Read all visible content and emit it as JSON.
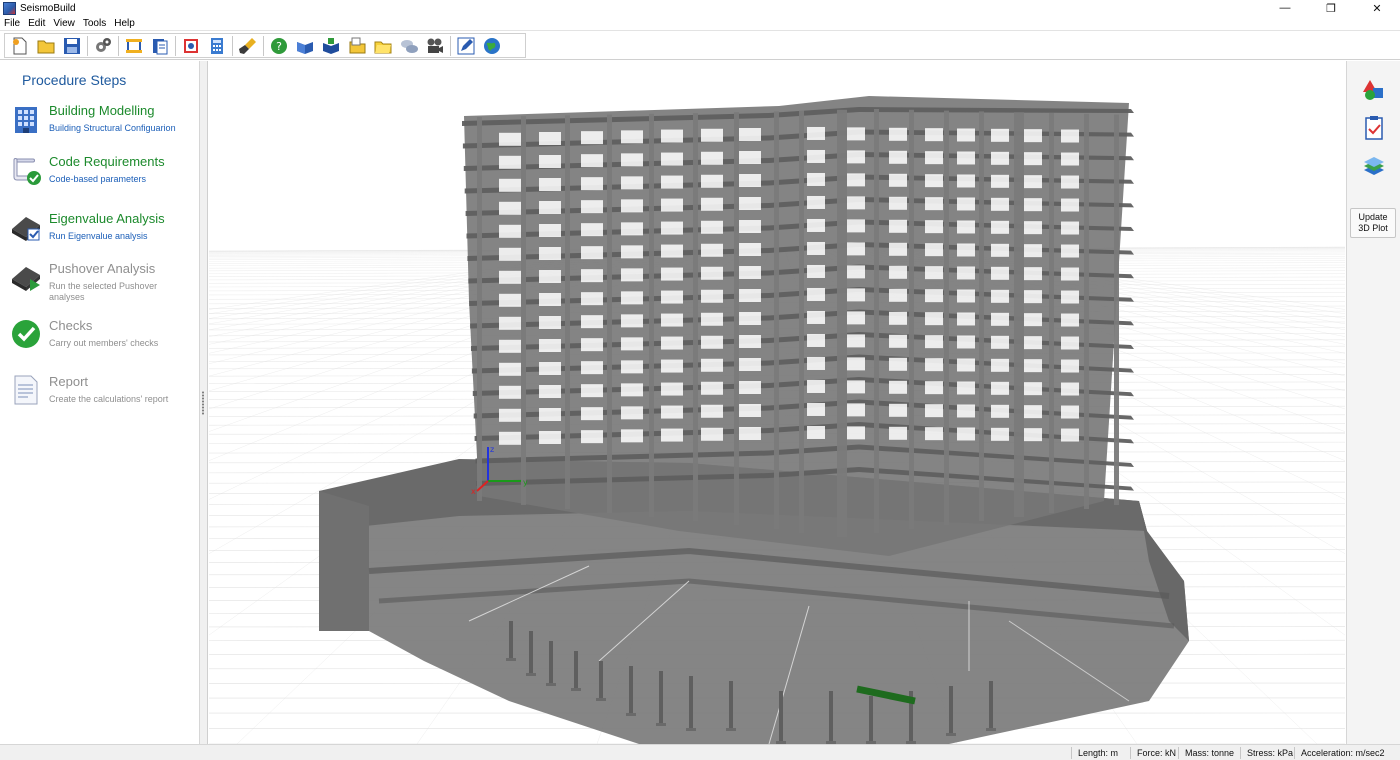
{
  "window": {
    "title": "SeismoBuild",
    "minimize_glyph": "—",
    "restore_glyph": "❐",
    "close_glyph": "✕"
  },
  "menu": [
    "File",
    "Edit",
    "View",
    "Tools",
    "Help"
  ],
  "toolbar": {
    "icons": [
      "new-file-icon",
      "open-folder-icon",
      "save-icon",
      "settings-gears-icon",
      "building-frame-icon",
      "calculation-sheet-icon",
      "structure-view-icon",
      "calculator-icon",
      "brush-icon",
      "help-icon",
      "manual-book-icon",
      "tutorial-book-icon",
      "examples-folder-icon",
      "folder-icon",
      "feedback-bubbles-icon",
      "video-camera-icon",
      "edit-pen-icon",
      "web-globe-icon"
    ]
  },
  "procedure": {
    "title": "Procedure Steps",
    "steps": [
      {
        "name": "Building Modelling",
        "desc": "Building Structural Configuarion",
        "icon": "building-icon",
        "state": "active"
      },
      {
        "name": "Code Requirements",
        "desc": "Code-based parameters",
        "icon": "code-scroll-check-icon",
        "state": "active"
      },
      {
        "name": "Eigenvalue Analysis",
        "desc": "Run Eigenvalue analysis",
        "icon": "eigenvalue-check-icon",
        "state": "active"
      },
      {
        "name": "Pushover Analysis",
        "desc": "Run the selected Pushover analyses",
        "icon": "pushover-play-icon",
        "state": "dim"
      },
      {
        "name": "Checks",
        "desc": "Carry out members' checks",
        "icon": "checkmark-circle-icon",
        "state": "dim"
      },
      {
        "name": "Report",
        "desc": "Create the calculations' report",
        "icon": "report-document-icon",
        "state": "dim"
      }
    ]
  },
  "viewport": {
    "axes": {
      "x": "x",
      "y": "y",
      "z": "z"
    },
    "colors": {
      "member": "#7a7a7a",
      "member_dark": "#5f5f5f",
      "slab": "#8a8a8a",
      "highlight": "#1e6b1e",
      "axis_x": "#d22",
      "axis_y": "#1a9a1a",
      "axis_z": "#2233dd"
    }
  },
  "rightpanel": {
    "icons": [
      "shapes-icon",
      "checklist-icon",
      "layers-icon"
    ],
    "update_label_1": "Update",
    "update_label_2": "3D Plot"
  },
  "status": {
    "length": "Length: m",
    "force": "Force: kN",
    "mass": "Mass: tonne",
    "stress": "Stress: kPa",
    "acceleration": "Acceleration: m/sec2"
  }
}
